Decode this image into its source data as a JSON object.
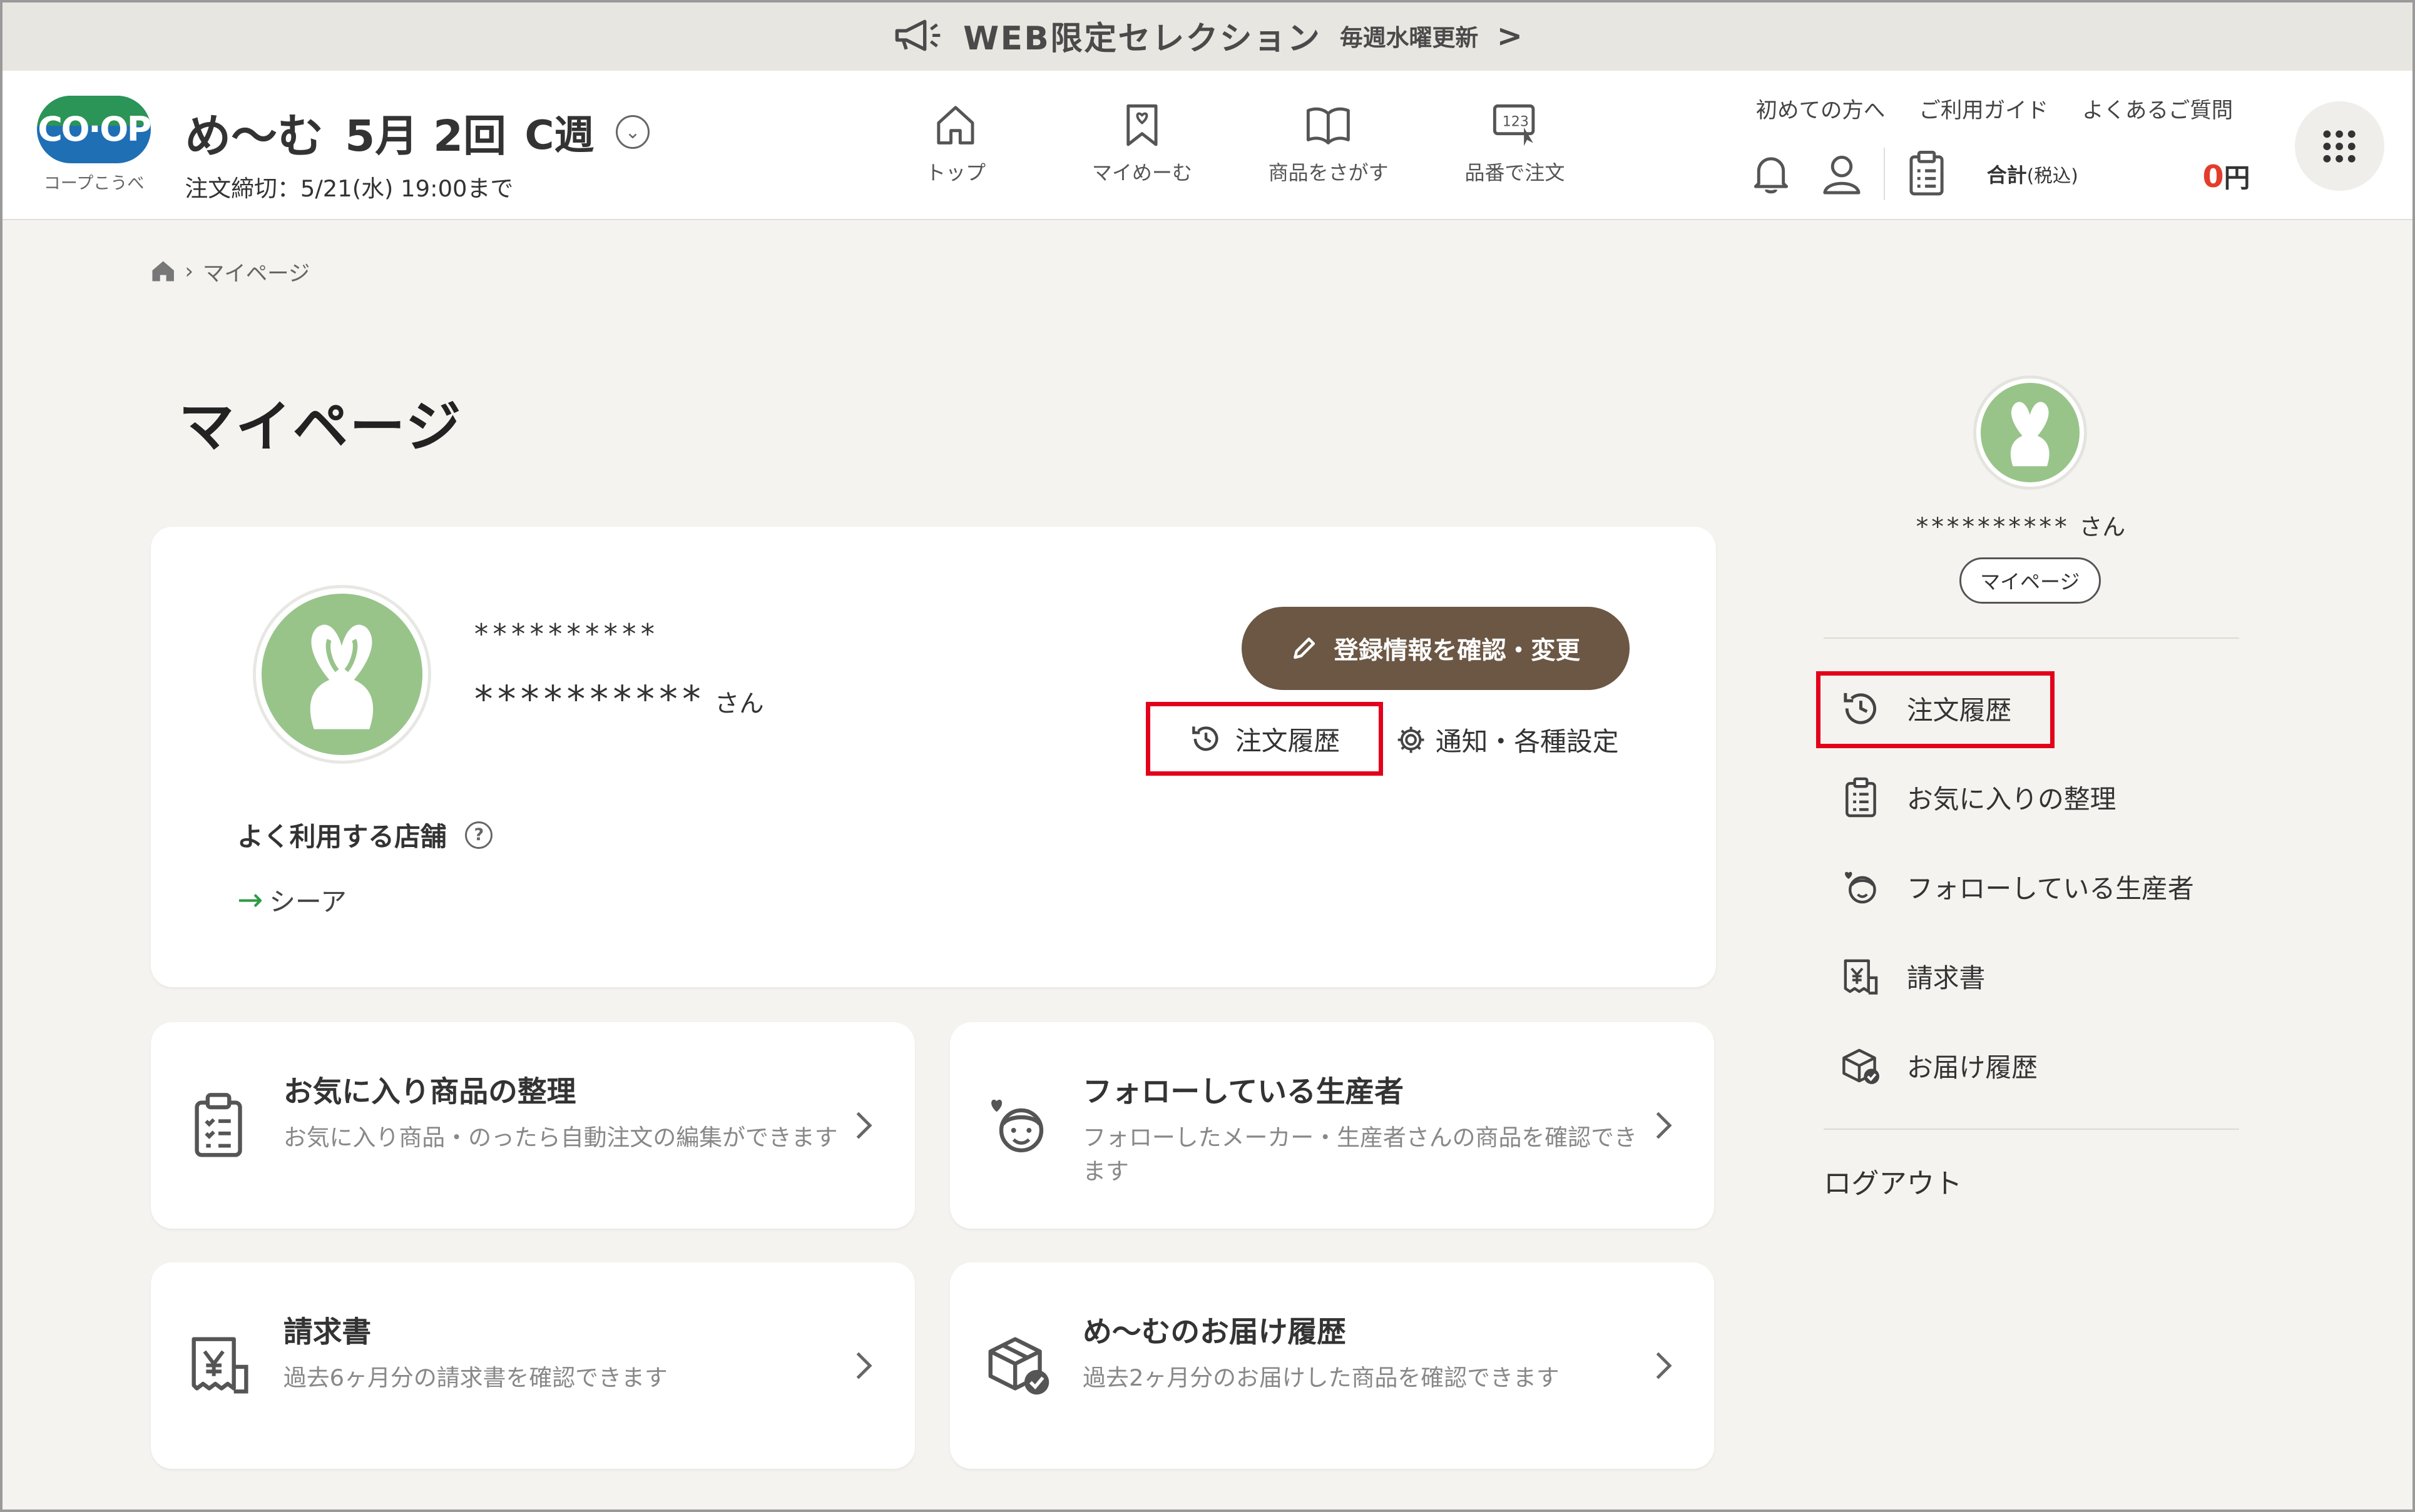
{
  "banner": {
    "main": "WEB限定セレクション",
    "sub": "毎週水曜更新",
    "chevron": ">"
  },
  "header": {
    "logo_text": "CO·OP",
    "logo_caption": "コープこうべ",
    "brand": "め〜む",
    "week": "5月 2回",
    "course": "C週",
    "deadline": "注文締切：5/21(水) 19:00まで",
    "nav": [
      {
        "label": "トップ",
        "icon": "home-icon"
      },
      {
        "label": "マイめーむ",
        "icon": "bookmark-heart-icon"
      },
      {
        "label": "商品をさがす",
        "icon": "book-icon"
      },
      {
        "label": "品番で注文",
        "icon": "number-cursor-icon"
      }
    ],
    "top_links": [
      "初めての方へ",
      "ご利用ガイド",
      "よくあるご質問"
    ],
    "total_label": "合計",
    "total_tax": "(税込)",
    "total_value": "0",
    "total_unit": "円"
  },
  "breadcrumb": {
    "current": "マイページ"
  },
  "page_title": "マイページ",
  "profile": {
    "name_top": "**********",
    "name_main": "**********",
    "honorific": "さん",
    "edit_button": "登録情報を確認・変更",
    "history_link": "注文履歴",
    "settings_link": "通知・各種設定",
    "store_title": "よく利用する店舗",
    "store_name": "シーア"
  },
  "cards": [
    {
      "title": "お気に入り商品の整理",
      "desc": "お気に入り商品・のったら自動注文の編集ができます",
      "icon": "clipboard-list-icon"
    },
    {
      "title": "フォローしている生産者",
      "desc": "フォローしたメーカー・生産者さんの商品を確認できます",
      "icon": "producer-heart-icon"
    },
    {
      "title": "請求書",
      "desc": "過去6ヶ月分の請求書を確認できます",
      "icon": "invoice-yen-icon"
    },
    {
      "title": "め〜むのお届け履歴",
      "desc": "過去2ヶ月分のお届けした商品を確認できます",
      "icon": "box-check-icon"
    }
  ],
  "sidebar": {
    "name": "**********",
    "honorific": "さん",
    "mypage_button": "マイページ",
    "items": [
      {
        "label": "注文履歴",
        "icon": "history-icon"
      },
      {
        "label": "お気に入りの整理",
        "icon": "clipboard-list-icon"
      },
      {
        "label": "フォローしている生産者",
        "icon": "producer-heart-icon"
      },
      {
        "label": "請求書",
        "icon": "invoice-yen-icon"
      },
      {
        "label": "お届け履歴",
        "icon": "box-check-icon"
      }
    ],
    "logout": "ログアウト"
  },
  "colors": {
    "accent_brown": "#6b5744",
    "highlight_red": "#e3001b",
    "price_red": "#e43c2c",
    "avatar_green": "#98c48a"
  }
}
